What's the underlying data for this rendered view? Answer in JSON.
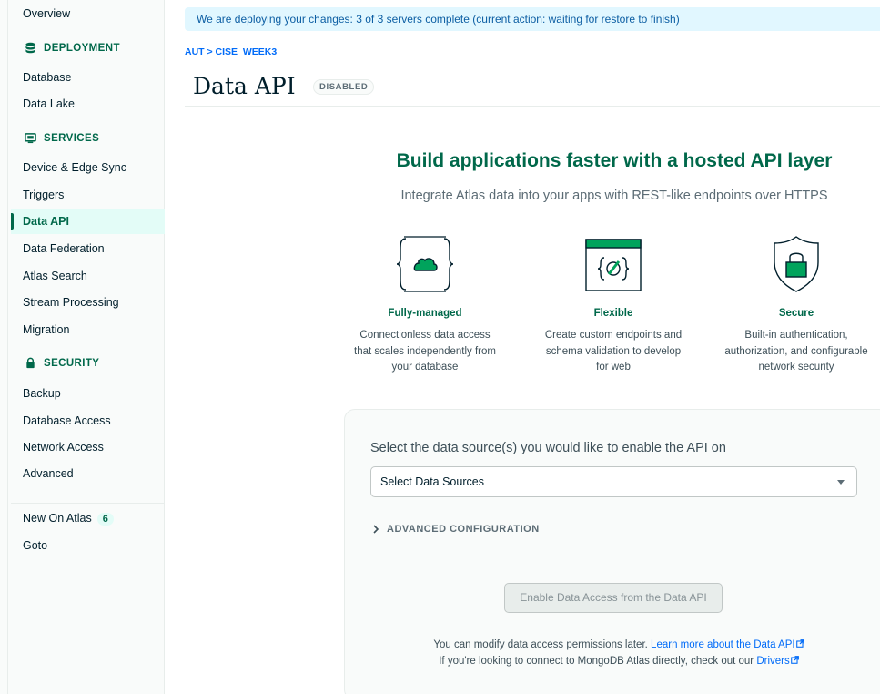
{
  "sidebar": {
    "top_items": [
      {
        "label": "Overview"
      }
    ],
    "sections": {
      "deployment": {
        "title": "DEPLOYMENT",
        "items": [
          "Database",
          "Data Lake"
        ]
      },
      "services": {
        "title": "SERVICES",
        "items": [
          "Device & Edge Sync",
          "Triggers",
          "Data API",
          "Data Federation",
          "Atlas Search",
          "Stream Processing",
          "Migration"
        ]
      },
      "security": {
        "title": "SECURITY",
        "items": [
          "Backup",
          "Database Access",
          "Network Access",
          "Advanced"
        ]
      }
    },
    "active_item": "Data API",
    "new_on_atlas": {
      "label": "New On Atlas",
      "count": "6"
    },
    "goto": "Goto"
  },
  "banner": {
    "text": "We are deploying your changes: 3 of 3 servers complete (current action: waiting for restore to finish)"
  },
  "breadcrumb": "AUT > CISE_WEEK3",
  "page": {
    "title": "Data API",
    "status_badge": "DISABLED"
  },
  "hero": {
    "title": "Build applications faster with a hosted API layer",
    "subtitle": "Integrate Atlas data into your apps with REST-like endpoints over HTTPS"
  },
  "features": [
    {
      "icon": "cloud-braces-icon",
      "title": "Fully-managed",
      "lines": [
        "Connectionless data access",
        "that scales independently from",
        "your database"
      ]
    },
    {
      "icon": "code-window-icon",
      "title": "Flexible",
      "lines": [
        "Create custom endpoints and",
        "schema validation to develop",
        "for web"
      ]
    },
    {
      "icon": "shield-lock-icon",
      "title": "Secure",
      "lines": [
        "Built-in authentication,",
        "authorization, and configurable",
        "network security"
      ]
    }
  ],
  "config": {
    "prompt": "Select the data source(s) you would like to enable the API on",
    "select_value": "Select Data Sources",
    "advanced_label": "ADVANCED CONFIGURATION",
    "enable_button": "Enable Data Access from the Data API",
    "note1_text": "You can modify data access permissions later.",
    "note1_link": "Learn more about the Data API",
    "note2_text": "If you're looking to connect to MongoDB Atlas directly, check out our",
    "note2_link": "Drivers"
  },
  "colors": {
    "brand_green": "#00684a",
    "link_blue": "#016bf8",
    "banner_bg": "#e1f7ff"
  }
}
